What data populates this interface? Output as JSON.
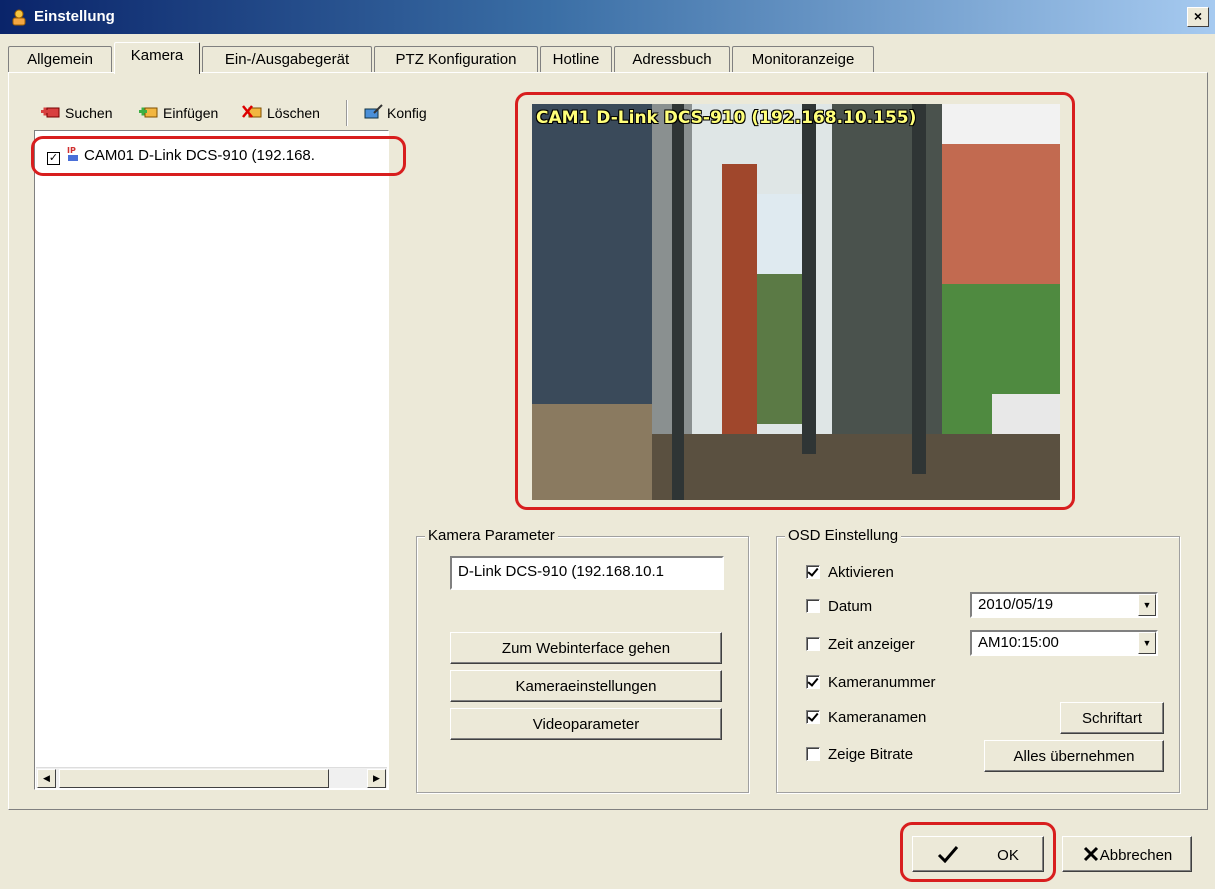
{
  "window": {
    "title": "Einstellung",
    "close_glyph": "×"
  },
  "tabs": [
    {
      "label": "Allgemein",
      "active": false
    },
    {
      "label": "Kamera",
      "active": true
    },
    {
      "label": "Ein-/Ausgabegerät",
      "active": false
    },
    {
      "label": "PTZ Konfiguration",
      "active": false
    },
    {
      "label": "Hotline",
      "active": false
    },
    {
      "label": "Adressbuch",
      "active": false
    },
    {
      "label": "Monitoranzeige",
      "active": false
    }
  ],
  "toolbar": {
    "search_label": "Suchen",
    "insert_label": "Einfügen",
    "delete_label": "Löschen",
    "config_label": "Konfig"
  },
  "camera_list": {
    "items": [
      {
        "label": "CAM01 D-Link DCS-910 (192.168.",
        "checked": true,
        "icon": "ip-camera-icon",
        "icon_text": "IP"
      }
    ]
  },
  "preview": {
    "overlay_label": "CAM1 D-Link DCS-910 (192.168.10.155)"
  },
  "camera_params": {
    "title": "Kamera Parameter",
    "name_value": "D-Link DCS-910 (192.168.10.1",
    "webinterface_label": "Zum Webinterface gehen",
    "settings_label": "Kameraeinstellungen",
    "video_label": "Videoparameter"
  },
  "osd": {
    "title": "OSD Einstellung",
    "activate_label": "Aktivieren",
    "activate_checked": true,
    "date_label": "Datum",
    "date_checked": false,
    "date_value": "2010/05/19",
    "time_label": "Zeit anzeiger",
    "time_checked": false,
    "time_value": "AM10:15:00",
    "camnum_label": "Kameranummer",
    "camnum_checked": true,
    "camname_label": "Kameranamen",
    "camname_checked": true,
    "bitrate_label": "Zeige Bitrate",
    "bitrate_checked": false,
    "font_button_label": "Schriftart",
    "apply_all_label": "Alles übernehmen"
  },
  "footer": {
    "ok_label": "OK",
    "cancel_label": "Abbrechen"
  },
  "colors": {
    "highlight_red": "#d81e1e",
    "title_bar": "#0a246a",
    "osd_text": "#ffff7a"
  }
}
